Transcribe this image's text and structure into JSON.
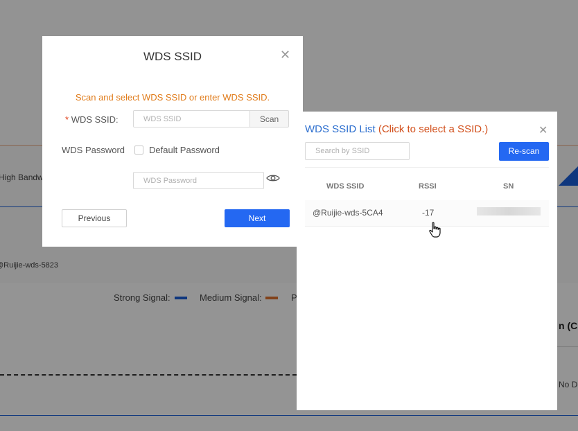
{
  "background": {
    "bandwidth_label": "High Bandw",
    "device_label": "@Ruijie-wds-5823",
    "legend": [
      {
        "label": "Strong Signal:",
        "color": "#1b5fd9"
      },
      {
        "label": "Medium Signal:",
        "color": "#e0722d"
      },
      {
        "label": "P"
      }
    ],
    "right_header": "n (CF",
    "right_text": "No De"
  },
  "wds_dialog": {
    "title": "WDS SSID",
    "hint": "Scan and select WDS SSID or enter WDS SSID.",
    "required_mark": "*",
    "ssid_label": "WDS SSID:",
    "ssid_placeholder": "WDS SSID",
    "scan_label": "Scan",
    "password_label": "WDS Password",
    "default_password_label": "Default Password",
    "default_password_checked": false,
    "password_placeholder": "WDS Password",
    "previous_label": "Previous",
    "next_label": "Next",
    "close_icon": "close-icon",
    "eye_icon": "eye-icon"
  },
  "ssid_list": {
    "title": "WDS SSID List",
    "title_hint": "(Click to select a SSID.)",
    "search_placeholder": "Search by SSID",
    "rescan_label": "Re-scan",
    "columns": [
      "WDS SSID",
      "RSSI",
      "SN"
    ],
    "rows": [
      {
        "ssid": "@Ruijie-wds-5CA4",
        "rssi": "-17",
        "sn": ""
      }
    ],
    "colors": {
      "accent": "#2468f2",
      "title": "#2d6fcf",
      "hint": "#d2501c",
      "warning": "#e07b1a"
    }
  }
}
